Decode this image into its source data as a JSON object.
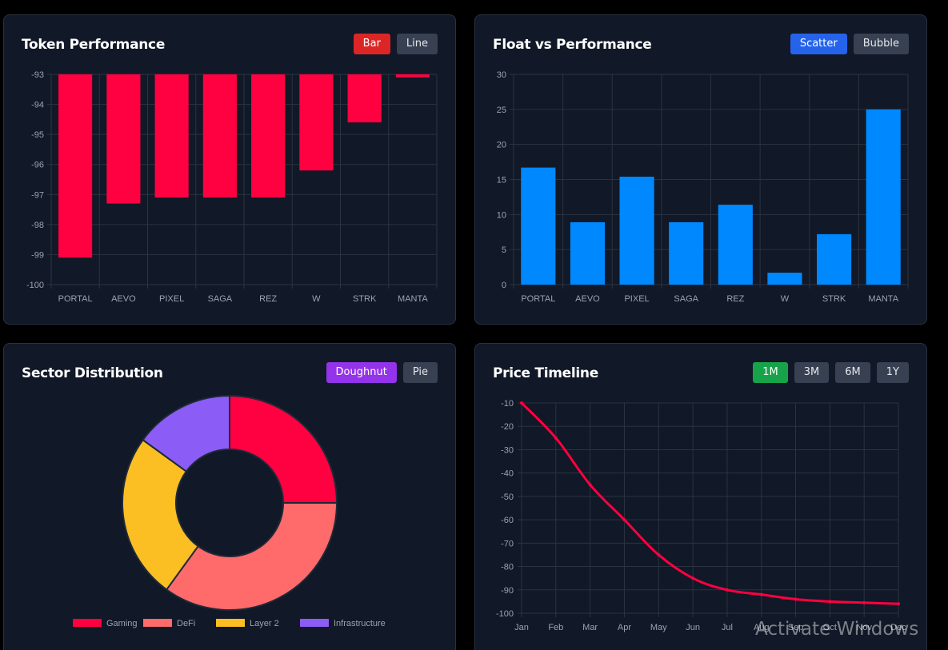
{
  "cards": {
    "performance": {
      "title": "Token Performance",
      "buttons": [
        {
          "label": "Bar",
          "active": true
        },
        {
          "label": "Line",
          "active": false
        }
      ]
    },
    "float": {
      "title": "Float vs Performance",
      "buttons": [
        {
          "label": "Scatter",
          "active": true
        },
        {
          "label": "Bubble",
          "active": false
        }
      ]
    },
    "sector": {
      "title": "Sector Distribution",
      "buttons": [
        {
          "label": "Doughnut",
          "active": true
        },
        {
          "label": "Pie",
          "active": false
        }
      ]
    },
    "timeline": {
      "title": "Price Timeline",
      "buttons": [
        {
          "label": "1M",
          "active": true
        },
        {
          "label": "3M",
          "active": false
        },
        {
          "label": "6M",
          "active": false
        },
        {
          "label": "1Y",
          "active": false
        }
      ]
    }
  },
  "colors": {
    "card_bg": "#111827",
    "grid": "#2b3340",
    "tick": "#9ca3af",
    "red": "#ff0040",
    "blue": "#0088ff"
  },
  "watermark": "Activate Windows",
  "chart_data": [
    {
      "id": "performance",
      "type": "bar",
      "categories": [
        "PORTAL",
        "AEVO",
        "PIXEL",
        "SAGA",
        "REZ",
        "W",
        "STRK",
        "MANTA"
      ],
      "values": [
        -99.1,
        -97.3,
        -97.1,
        -97.1,
        -97.1,
        -96.2,
        -94.6,
        -93.1
      ],
      "ylim": [
        -100,
        -93
      ],
      "yticks": [
        -93,
        -94,
        -95,
        -96,
        -97,
        -98,
        -99,
        -100
      ],
      "color": "#ff0040",
      "grid": true
    },
    {
      "id": "float",
      "type": "bar",
      "categories": [
        "PORTAL",
        "AEVO",
        "PIXEL",
        "SAGA",
        "REZ",
        "W",
        "STRK",
        "MANTA"
      ],
      "values": [
        16.7,
        8.9,
        15.4,
        8.9,
        11.4,
        1.7,
        7.2,
        25
      ],
      "ylim": [
        0,
        30
      ],
      "yticks": [
        30,
        25,
        20,
        15,
        10,
        5,
        0
      ],
      "color": "#0088ff",
      "grid": true
    },
    {
      "id": "sector",
      "type": "pie",
      "labels": [
        "Gaming",
        "DeFi",
        "Layer 2",
        "Infrastructure"
      ],
      "values": [
        25,
        35,
        25,
        15
      ],
      "colors": [
        "#ff0040",
        "#ff6b6b",
        "#fbbf24",
        "#8b5cf6"
      ],
      "legend": "bottom"
    },
    {
      "id": "timeline",
      "type": "line",
      "x": [
        "Jan",
        "Feb",
        "Mar",
        "Apr",
        "May",
        "Jun",
        "Jul",
        "Aug",
        "Sep",
        "Oct",
        "Nov",
        "Dec"
      ],
      "values": [
        -10,
        -25,
        -45,
        -60,
        -75,
        -85,
        -90,
        -92,
        -94,
        -95,
        -95.5,
        -96
      ],
      "ylim": [
        -100,
        -10
      ],
      "yticks": [
        -10,
        -20,
        -30,
        -40,
        -50,
        -60,
        -70,
        -80,
        -90,
        -100
      ],
      "color": "#ff0040",
      "grid": true
    }
  ]
}
